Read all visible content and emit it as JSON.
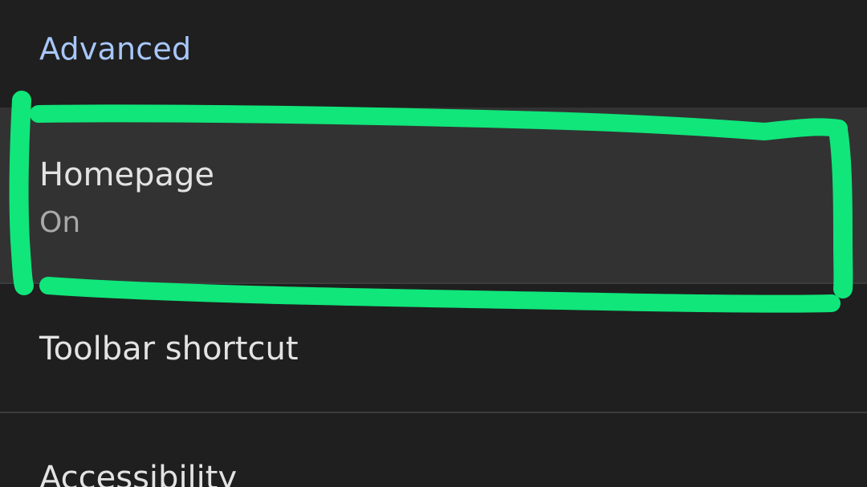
{
  "section": {
    "title": "Advanced"
  },
  "items": [
    {
      "title": "Homepage",
      "summary": "On"
    },
    {
      "title": "Toolbar shortcut"
    },
    {
      "title": "Accessibility"
    }
  ],
  "annotation": {
    "color": "#10e67a",
    "shape": "hand-drawn-rectangle",
    "target": "Homepage"
  }
}
